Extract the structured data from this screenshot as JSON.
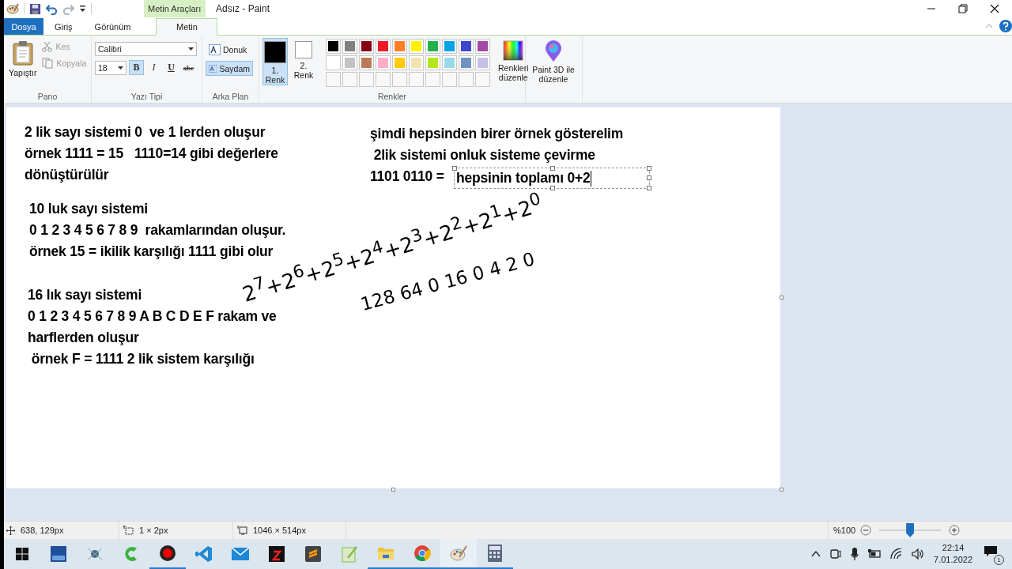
{
  "window": {
    "title": "Adsız - Paint",
    "context_tab": "Metin Araçları"
  },
  "tabs": [
    {
      "label": "Dosya",
      "kind": "file",
      "selected": false
    },
    {
      "label": "Giriş",
      "kind": "tab",
      "selected": false
    },
    {
      "label": "Görünüm",
      "kind": "tab",
      "selected": false
    },
    {
      "label": "Metin",
      "kind": "tab",
      "selected": true
    }
  ],
  "clipboard": {
    "label": "Pano",
    "paste": "Yapıştır",
    "cut": {
      "label": "Kes",
      "disabled": true
    },
    "copy": {
      "label": "Kopyala",
      "disabled": true
    }
  },
  "font": {
    "label": "Yazı Tipi",
    "family": "Calibri",
    "size": "18",
    "styles": [
      {
        "kind": "bold",
        "label": "B",
        "on": true
      },
      {
        "kind": "italic",
        "label": "I",
        "on": false
      },
      {
        "kind": "underline",
        "label": "U",
        "on": false
      },
      {
        "kind": "strike",
        "label": "abc",
        "on": false
      }
    ]
  },
  "background": {
    "label": "Arka Plan",
    "options": [
      {
        "label": "Donuk",
        "selected": false
      },
      {
        "label": "Saydam",
        "selected": true
      }
    ]
  },
  "colors": {
    "label": "Renkler",
    "slots": [
      {
        "label": "1. Renk",
        "color": "#000000",
        "selected": true
      },
      {
        "label": "2. Renk",
        "color": "#ffffff",
        "selected": false
      }
    ],
    "palette": [
      {
        "color": "#000000"
      },
      {
        "color": "#7f7f7f"
      },
      {
        "color": "#880015"
      },
      {
        "color": "#ed1c24"
      },
      {
        "color": "#ff7f27"
      },
      {
        "color": "#fff200"
      },
      {
        "color": "#22b14c"
      },
      {
        "color": "#00a2e8"
      },
      {
        "color": "#3f48cc"
      },
      {
        "color": "#a349a4"
      },
      {
        "color": "#ffffff"
      },
      {
        "color": "#c3c3c3"
      },
      {
        "color": "#b97a57"
      },
      {
        "color": "#ffaec9"
      },
      {
        "color": "#ffc90e"
      },
      {
        "color": "#efe4b0"
      },
      {
        "color": "#b5e61d"
      },
      {
        "color": "#99d9ea"
      },
      {
        "color": "#7092be"
      },
      {
        "color": "#c8bfe7"
      }
    ],
    "edit_colors": "Renkleri düzenle"
  },
  "paint3d": "Paint 3D ile düzenle",
  "canvas": {
    "blocks": [
      {
        "lines": [
          "2 lik sayı sistemi 0  ve 1 lerden oluşur",
          "örnek 1111 = 15   1110=14 gibi değerlere",
          "dönüştürülür"
        ]
      },
      {
        "lines": [
          "10 luk sayı sistemi",
          "0 1 2 3 4 5 6 7 8 9  rakamlarından oluşur.",
          "örnek 15 = ikilik karşılığı 1111 gibi olur"
        ]
      },
      {
        "lines": [
          "16 lık sayı sistemi",
          "0 1 2 3 4 5 6 7 8 9 A B C D E F rakam ve",
          "harflerden oluşur",
          " örnek F = 1111 2 lik sistem karşılığı"
        ]
      },
      {
        "lines": [
          "şimdi hepsinden birer örnek gösterelim",
          " 2lik sistemi onluk sisteme çevirme",
          "1101 0110 ="
        ]
      }
    ],
    "active_text": "hepsinin toplamı 0+2",
    "handwriting": [
      "2$^{7}$+2$^{6}$+2$^{5}$+2$^{4}$+2$^{3}$+2$^{2}$+2$^{1}$+2$^{0}$",
      "128 64 0 16 0 4 2 0"
    ]
  },
  "status_bar": {
    "cursor": "638, 129px",
    "selection": "1 × 2px",
    "image_size": "1046 × 514px",
    "zoom": "%100",
    "zoom_level": {
      "level": 0.5
    }
  },
  "taskbar": {
    "apps": [
      {
        "kind": "dev",
        "running": false
      },
      {
        "kind": "network",
        "running": false
      },
      {
        "kind": "green",
        "running": false
      },
      {
        "kind": "record",
        "running": true
      },
      {
        "kind": "code",
        "running": false
      },
      {
        "kind": "mail",
        "running": false
      },
      {
        "kind": "chip",
        "running": false
      },
      {
        "kind": "sublime",
        "running": false
      },
      {
        "kind": "notepad",
        "running": false
      },
      {
        "kind": "folder",
        "running": true
      },
      {
        "kind": "chrome",
        "running": true
      },
      {
        "kind": "paint",
        "running": true
      },
      {
        "kind": "calculator",
        "running": true
      }
    ],
    "time": "22:14",
    "date": "7.01.2022",
    "notifications": "1"
  }
}
